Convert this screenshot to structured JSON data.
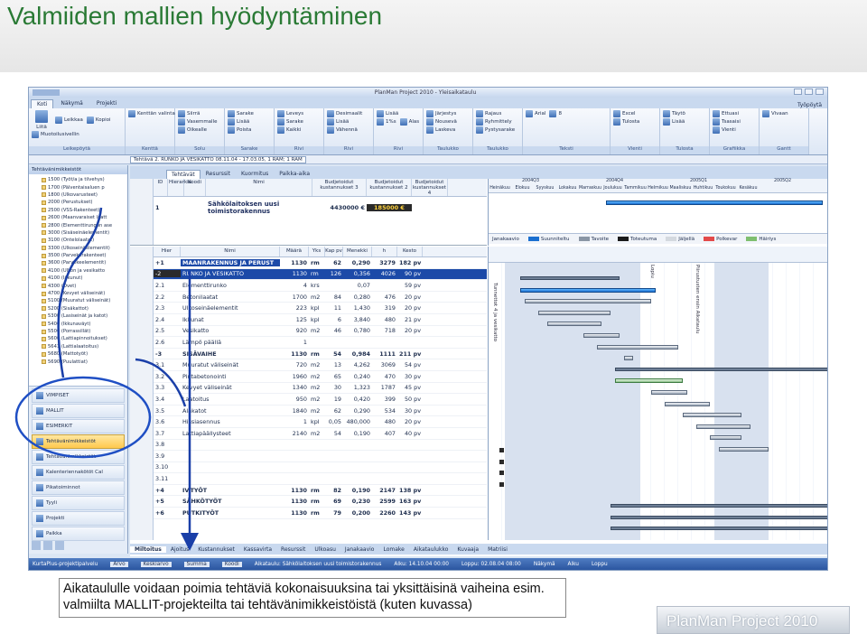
{
  "slide": {
    "title": "Valmiiden mallien hyödyntäminen",
    "caption_line1": "Aikataululle voidaan poimia tehtäviä kokonaisuuksina tai yksittäisinä vaiheina esim.",
    "caption_line2": "valmiilta MALLIT-projekteilta tai tehtävänimikkeistöistä (kuten kuvassa)",
    "brand": "PlanMan Project 2010",
    "accent_color": "#2a7a35"
  },
  "app": {
    "window_title": "PlanMan Project 2010 - Yleisaikataulu",
    "tabs": [
      "Koti",
      "Näkymä",
      "Projekti"
    ],
    "tab_right": "Työpöytä",
    "ribbon_groups": [
      {
        "name": "Leikepöytä",
        "buttons": [
          "Liitä",
          "Leikkaa",
          "Kopioi",
          "Muotoilusivellin"
        ]
      },
      {
        "name": "Kenttä",
        "buttons": [
          "Kenttän valinta"
        ]
      },
      {
        "name": "Solu",
        "buttons": [
          "Siirrä",
          "Vasemmalle",
          "Oikealle"
        ]
      },
      {
        "name": "Sarake",
        "buttons": [
          "Sarake",
          "Lisää",
          "Poista"
        ]
      },
      {
        "name": "Rivi",
        "buttons": [
          "Leveys",
          "Sarake",
          "Kaikki"
        ]
      },
      {
        "name": "Rivi",
        "buttons": [
          "Desimaalit",
          "Lisää",
          "Vähennä"
        ]
      },
      {
        "name": "Rivi",
        "buttons": [
          "Lisää",
          "1%s",
          "Alas"
        ]
      },
      {
        "name": "Taulukko",
        "buttons": [
          "Järjestys",
          "Nousevä",
          "Laskeva"
        ]
      },
      {
        "name": "Taulukko",
        "buttons": [
          "Rajaus",
          "Ryhmittely",
          "Pystysarake"
        ]
      },
      {
        "name": "Teksti",
        "buttons": [
          "Arial",
          "8"
        ]
      },
      {
        "name": "Vienti",
        "buttons": [
          "Excel",
          "Tulosta"
        ]
      },
      {
        "name": "Tulosta",
        "buttons": [
          "Täytö",
          "Lisää"
        ]
      },
      {
        "name": "Grafiikka",
        "buttons": [
          "Ettuasi",
          "Tsasaisi",
          "Vienti"
        ]
      },
      {
        "name": "Gantt",
        "buttons": [
          "Vivaan"
        ]
      }
    ],
    "infobar": {
      "label": "Tehtävä 2. RUNKO JA VESIKATTO 08.11.04 - 17.03.05, 1 RAM; 1 RAM",
      "nav_title": "Tehtävänimikkeistöt"
    },
    "tree_items": [
      "1500 (Työt/a ja tilvehys)",
      "1700 (Pälventaisaluen p",
      "1800 (Ulkovarusteet)",
      "2000 (Perustukset)",
      "2500 (VSS-Rakenteet)",
      "2600 (Maanvaraiset laatt",
      "2800 (Elementtirungon ase",
      "3000 (Sisäseinäelementit)",
      "3100 (Ontelolaatat)",
      "3300 (Ulkoseinäelementit)",
      "3500 (Parvekerakenteet)",
      "3600 (Parvekeelementit)",
      "4100 (Ulkon ja vesikatto",
      "4100 (Iäkunut)",
      "4300 (Ovet)",
      "4700 (Kevyet väliseinät)",
      "5100 (Muuratut väliseinät)",
      "5200 (Sisäkattot)",
      "5300 (Lasiseinät ja katot)",
      "5400 (Ikkunaväyt)",
      "5500 (Porrassillät)",
      "5600 (Lattiapinnoitukset)",
      "5641 (Lattialaatoitus)",
      "5680 (Mattotyöt)",
      "5690 (Puulattiat)"
    ],
    "panels": [
      "VIMPISET",
      "MALLIT",
      "ESIMERKIT",
      "Tehtävänimikkeistöt",
      "Tehtävänimikkeistöt",
      "Kalenteriennakötöt Cal",
      "Pikatoiminnot",
      "Tyyli",
      "Projekti",
      "Paikka"
    ],
    "panel_active": "Tehtävänimikkeistöt",
    "doc_tabs": [
      "Tehtävät",
      "Resurssit",
      "Kuormitus",
      "Paikka-aika"
    ],
    "grid1": {
      "headers": [
        "ID",
        "Hierarkia",
        "Koodi",
        "Nimi",
        "Budjetoidut kustannukset 3",
        "Budjetoidut kustannukset 2",
        "Budjetoidut kustannukset 4"
      ],
      "row": {
        "id": "1",
        "name": "Sähkölaitoksen uusi toimistorakennus",
        "v1": "4430000 €",
        "v2": "185000 €"
      }
    },
    "gantt_scale_years": [
      "2004Q3",
      "2004Q4",
      "2005Q1",
      "2005Q2"
    ],
    "gantt_scale_months": [
      "Heinäkuu",
      "Elokuu",
      "Syyskuu",
      "Lokakuu",
      "Marraskuu",
      "Joulukuu",
      "Tammikuu",
      "Helmikuu",
      "Maaliskuu",
      "Huhtikuu",
      "Toukokuu",
      "Kesäkuu"
    ],
    "legend": [
      {
        "label": "Suunniteltu",
        "color": "#1a6fd0"
      },
      {
        "label": "Tavoite",
        "color": "#8a96a5"
      },
      {
        "label": "Toteutuma",
        "color": "#1a1a1a"
      },
      {
        "label": "Jäljellä",
        "color": "#d4d9df"
      },
      {
        "label": "Polkevar",
        "color": "#e34a4a"
      },
      {
        "label": "Häiriys",
        "color": "#7fbf6f"
      }
    ],
    "grid2_headers": [
      "Hier",
      "Nimi",
      "Määrä",
      "Yks",
      "Kap pv",
      "Menekki",
      "h",
      "Kesto"
    ],
    "rows": [
      {
        "num": "1",
        "hier": "+1",
        "name": "MAANRAKENNUS JA PERUST",
        "qty": "1130",
        "unit": "rm",
        "kap": "62",
        "men": "0,290",
        "h": "3279",
        "dur": "182 pv",
        "type": "sum",
        "hl": true
      },
      {
        "num": "2",
        "hier": "-2",
        "name": "RUNKO JA VESIKATTO",
        "qty": "1130",
        "unit": "rm",
        "kap": "126",
        "men": "0,356",
        "h": "4026",
        "dur": "90 pv",
        "type": "sel"
      },
      {
        "num": "3",
        "hier": "2.1",
        "name": "Elementtirunko",
        "qty": "4",
        "unit": "krs",
        "kap": "",
        "men": "0,07",
        "h": "",
        "dur": "59 pv",
        "type": "task"
      },
      {
        "num": "4",
        "hier": "2.2",
        "name": "Betonilaatat",
        "qty": "1700",
        "unit": "m2",
        "kap": "84",
        "men": "0,280",
        "h": "476",
        "dur": "20 pv",
        "type": "task"
      },
      {
        "num": "5",
        "hier": "2.3",
        "name": "Ulkoseinäelementit",
        "qty": "223",
        "unit": "kpl",
        "kap": "11",
        "men": "1,430",
        "h": "319",
        "dur": "20 pv",
        "type": "task"
      },
      {
        "num": "6",
        "hier": "2.4",
        "name": "Ikkunat",
        "qty": "125",
        "unit": "kpl",
        "kap": "6",
        "men": "3,840",
        "h": "480",
        "dur": "21 pv",
        "type": "task"
      },
      {
        "num": "7",
        "hier": "2.5",
        "name": "Vesikatto",
        "qty": "920",
        "unit": "m2",
        "kap": "46",
        "men": "0,780",
        "h": "718",
        "dur": "20 pv",
        "type": "task"
      },
      {
        "num": "8",
        "hier": "2.6",
        "name": "Lämpö päällä",
        "qty": "1",
        "unit": "",
        "kap": "",
        "men": "",
        "h": "",
        "dur": "",
        "type": "task"
      },
      {
        "num": "9",
        "hier": "-3",
        "name": "SISÄVAIHE",
        "qty": "1130",
        "unit": "rm",
        "kap": "54",
        "men": "0,984",
        "h": "1111",
        "dur": "211 pv",
        "type": "sum"
      },
      {
        "num": "10",
        "hier": "3.1",
        "name": "Muuratut väliseinät",
        "qty": "720",
        "unit": "m2",
        "kap": "13",
        "men": "4,262",
        "h": "3069",
        "dur": "54 pv",
        "type": "task"
      },
      {
        "num": "11",
        "hier": "3.2",
        "name": "Pintabetonointi",
        "qty": "1960",
        "unit": "m2",
        "kap": "65",
        "men": "0,240",
        "h": "470",
        "dur": "30 pv",
        "type": "task"
      },
      {
        "num": "12",
        "hier": "3.3",
        "name": "Kevyet väliseinät",
        "qty": "1340",
        "unit": "m2",
        "kap": "30",
        "men": "1,323",
        "h": "1787",
        "dur": "45 pv",
        "type": "task"
      },
      {
        "num": "13",
        "hier": "3.4",
        "name": "Laatoitus",
        "qty": "950",
        "unit": "m2",
        "kap": "19",
        "men": "0,420",
        "h": "399",
        "dur": "50 pv",
        "type": "task"
      },
      {
        "num": "14",
        "hier": "3.5",
        "name": "Alakatot",
        "qty": "1840",
        "unit": "m2",
        "kap": "62",
        "men": "0,290",
        "h": "534",
        "dur": "30 pv",
        "type": "task"
      },
      {
        "num": "15",
        "hier": "3.6",
        "name": "Hissiasennus",
        "qty": "1",
        "unit": "kpl",
        "kap": "0,05",
        "men": "480,000",
        "h": "480",
        "dur": "20 pv",
        "type": "task"
      },
      {
        "num": "16",
        "hier": "3.7",
        "name": "Lattiapäällysteet",
        "qty": "2140",
        "unit": "m2",
        "kap": "54",
        "men": "0,190",
        "h": "407",
        "dur": "40 pv",
        "type": "task"
      },
      {
        "num": "17",
        "hier": "3.8",
        "name": "",
        "qty": "",
        "unit": "",
        "kap": "",
        "men": "",
        "h": "",
        "dur": "",
        "type": "task"
      },
      {
        "num": "18",
        "hier": "3.9",
        "name": "",
        "qty": "",
        "unit": "",
        "kap": "",
        "men": "",
        "h": "",
        "dur": "",
        "type": "task"
      },
      {
        "num": "19",
        "hier": "3.10",
        "name": "",
        "qty": "",
        "unit": "",
        "kap": "",
        "men": "",
        "h": "",
        "dur": "",
        "type": "task"
      },
      {
        "num": "20",
        "hier": "3.11",
        "name": "",
        "qty": "",
        "unit": "",
        "kap": "",
        "men": "",
        "h": "",
        "dur": "",
        "type": "task"
      },
      {
        "num": "21",
        "hier": "+4",
        "name": "IV-TYÖT",
        "qty": "1130",
        "unit": "rm",
        "kap": "82",
        "men": "0,190",
        "h": "2147",
        "dur": "138 pv",
        "type": "sum"
      },
      {
        "num": "22",
        "hier": "+5",
        "name": "SÄHKÖTYÖT",
        "qty": "1130",
        "unit": "rm",
        "kap": "69",
        "men": "0,230",
        "h": "2599",
        "dur": "163 pv",
        "type": "sum"
      },
      {
        "num": "23",
        "hier": "+6",
        "name": "PUTKITYÖT",
        "qty": "1130",
        "unit": "rm",
        "kap": "79",
        "men": "0,200",
        "h": "2260",
        "dur": "143 pv",
        "type": "sum"
      }
    ],
    "gantt_labels": {
      "kaavio": "Janakaavio",
      "hidden": "Lopiu",
      "vertical1": "Tunnettot 4 ja vesikatto",
      "vertical2": "Piirustusten ensin Aikataulu"
    },
    "bottom_tabs": [
      "Miltoitus",
      "Ajoitus",
      "Kustannukset",
      "Kassavirta",
      "Resurssit",
      "Ulkoasu",
      "Janakaavio",
      "Lomake",
      "Aikataulukko",
      "Kuvaaja",
      "Matriisi"
    ],
    "bottom_active": "Miltoitus",
    "status": {
      "left": "KurtaPlus-projektipalvelu",
      "fields": [
        "Arvo",
        "Keskiarvo",
        "Summa",
        "Koodi"
      ],
      "project": "Aikataulu: Sähkölaitoksen uusi toimistorakennus",
      "start": "Alku: 14.10.04 00:00",
      "end": "Loppu: 02.08.04 08:00",
      "view": "Näkymä",
      "zoom_start": "Alku",
      "zoom_end": "Loppu"
    }
  }
}
